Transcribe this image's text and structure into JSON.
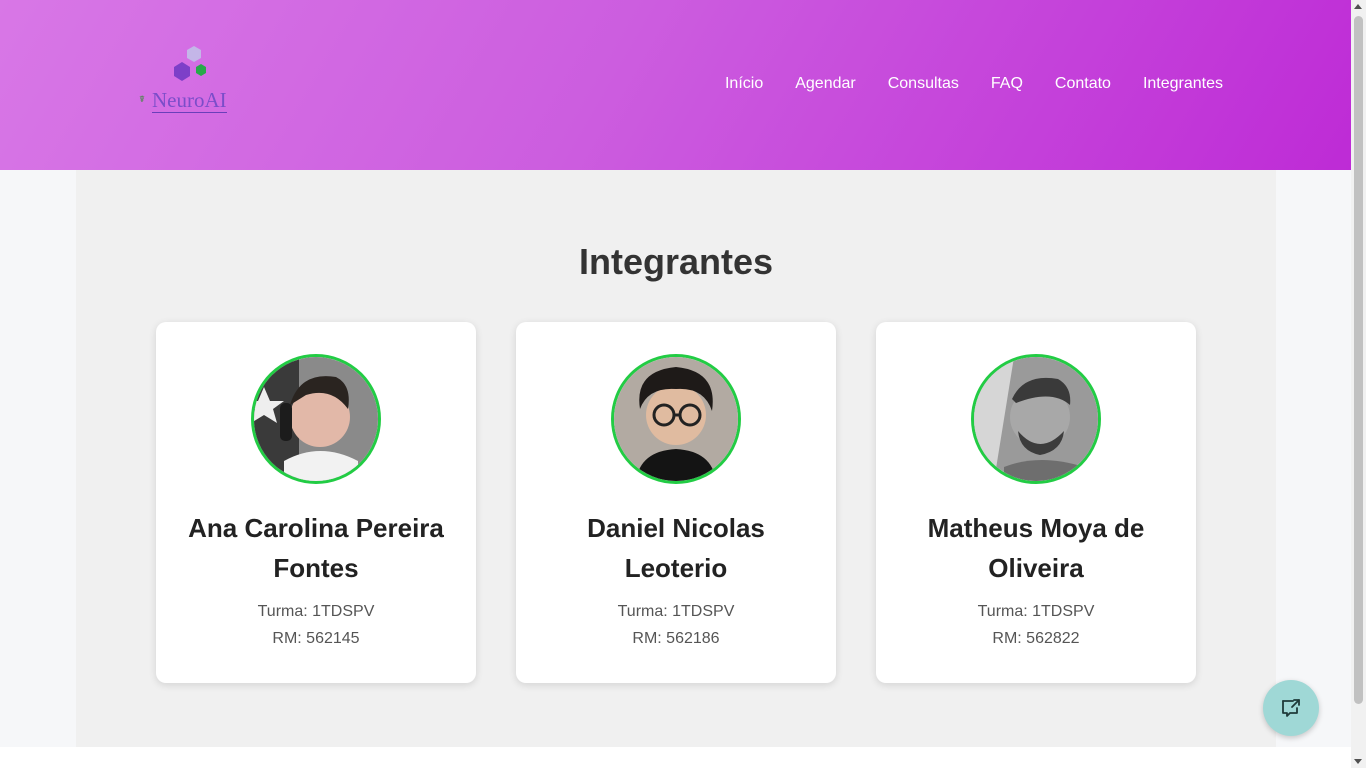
{
  "brand": {
    "name_main": "Neuro",
    "name_ai": "AI",
    "mini_mark": "☤"
  },
  "nav": {
    "items": [
      {
        "label": "Início"
      },
      {
        "label": "Agendar"
      },
      {
        "label": "Consultas"
      },
      {
        "label": "FAQ"
      },
      {
        "label": "Contato"
      },
      {
        "label": "Integrantes"
      }
    ]
  },
  "main": {
    "title": "Integrantes",
    "members": [
      {
        "name": "Ana Carolina Pereira Fontes",
        "turma": "Turma: 1TDSPV",
        "rm": "RM: 562145"
      },
      {
        "name": "Daniel Nicolas Leoterio",
        "turma": "Turma: 1TDSPV",
        "rm": "RM: 562186"
      },
      {
        "name": "Matheus Moya de Oliveira",
        "turma": "Turma: 1TDSPV",
        "rm": "RM: 562822"
      }
    ]
  },
  "colors": {
    "header_start": "#d877e6",
    "header_end": "#be2bd6",
    "avatar_border": "#22cc44",
    "fab": "#9fd8d6"
  },
  "icons": {
    "fab": "chat-share-icon",
    "logo": "hexagon-molecule-icon"
  }
}
